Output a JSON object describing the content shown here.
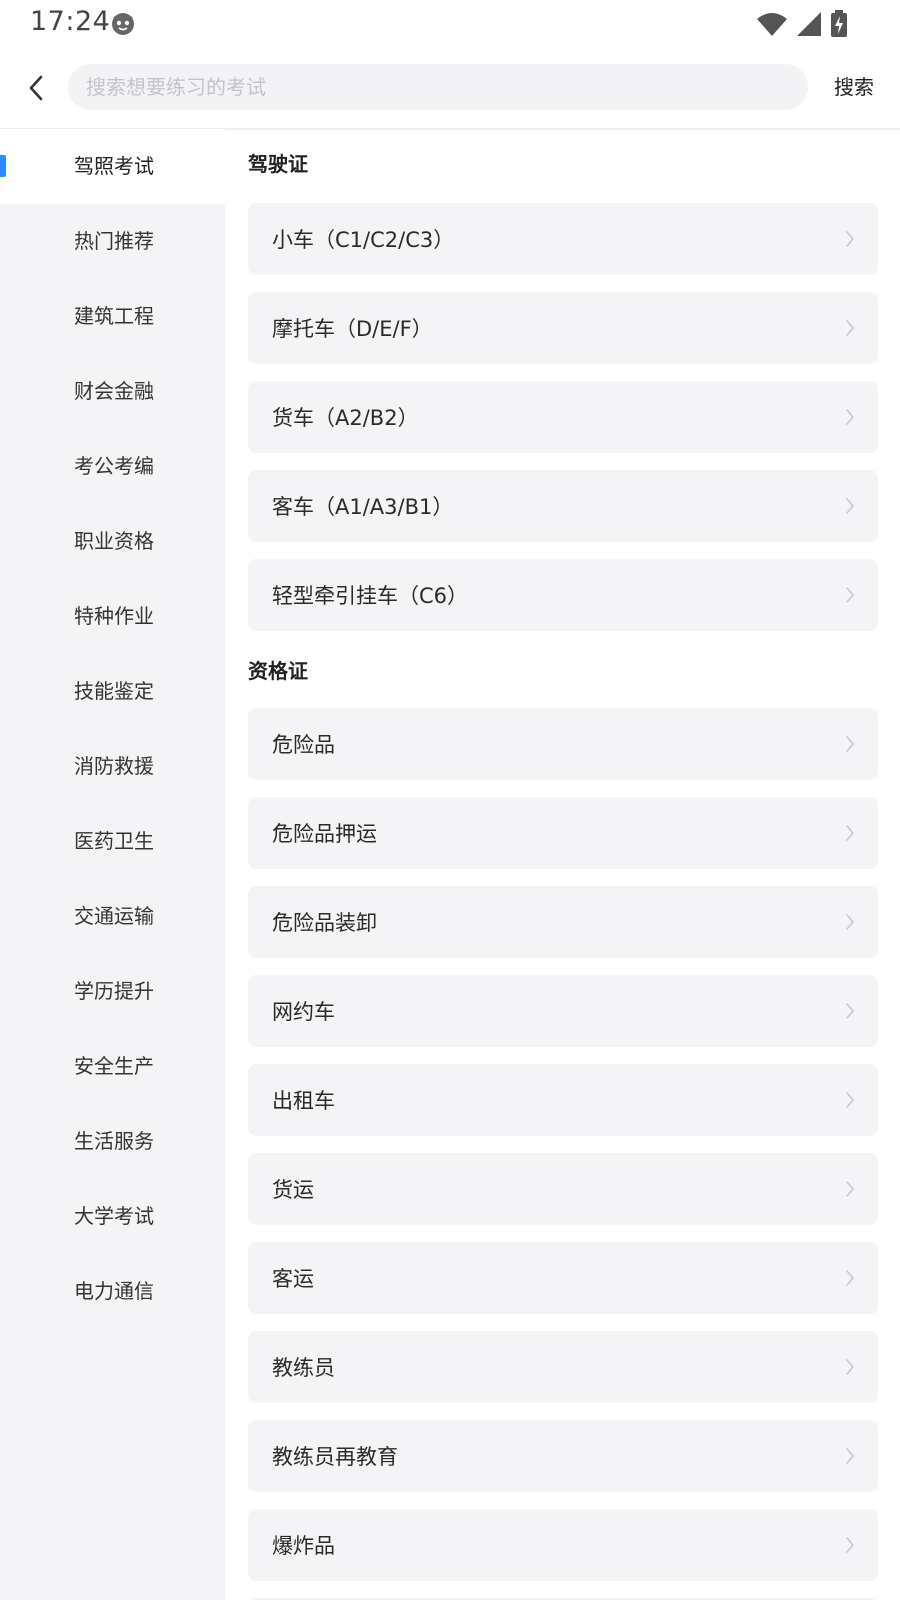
{
  "status": {
    "time": "17:24"
  },
  "search": {
    "placeholder": "搜索想要练习的考试",
    "button": "搜索"
  },
  "sidebar": {
    "items": [
      {
        "label": "驾照考试",
        "active": true
      },
      {
        "label": "热门推荐"
      },
      {
        "label": "建筑工程"
      },
      {
        "label": "财会金融"
      },
      {
        "label": "考公考编"
      },
      {
        "label": "职业资格"
      },
      {
        "label": "特种作业"
      },
      {
        "label": "技能鉴定"
      },
      {
        "label": "消防救援"
      },
      {
        "label": "医药卫生"
      },
      {
        "label": "交通运输"
      },
      {
        "label": "学历提升"
      },
      {
        "label": "安全生产"
      },
      {
        "label": "生活服务"
      },
      {
        "label": "大学考试"
      },
      {
        "label": "电力通信"
      }
    ]
  },
  "sections": [
    {
      "title": "驾驶证",
      "items": [
        "小车（C1/C2/C3）",
        "摩托车（D/E/F）",
        "货车（A2/B2）",
        "客车（A1/A3/B1）",
        "轻型牵引挂车（C6）"
      ]
    },
    {
      "title": "资格证",
      "items": [
        "危险品",
        "危险品押运",
        "危险品装卸",
        "网约车",
        "出租车",
        "货运",
        "客运",
        "教练员",
        "教练员再教育",
        "爆炸品"
      ]
    }
  ],
  "colors": {
    "accent": "#2e8bff",
    "sidebar_bg": "#f4f4f6",
    "row_bg": "#f4f4f6"
  }
}
